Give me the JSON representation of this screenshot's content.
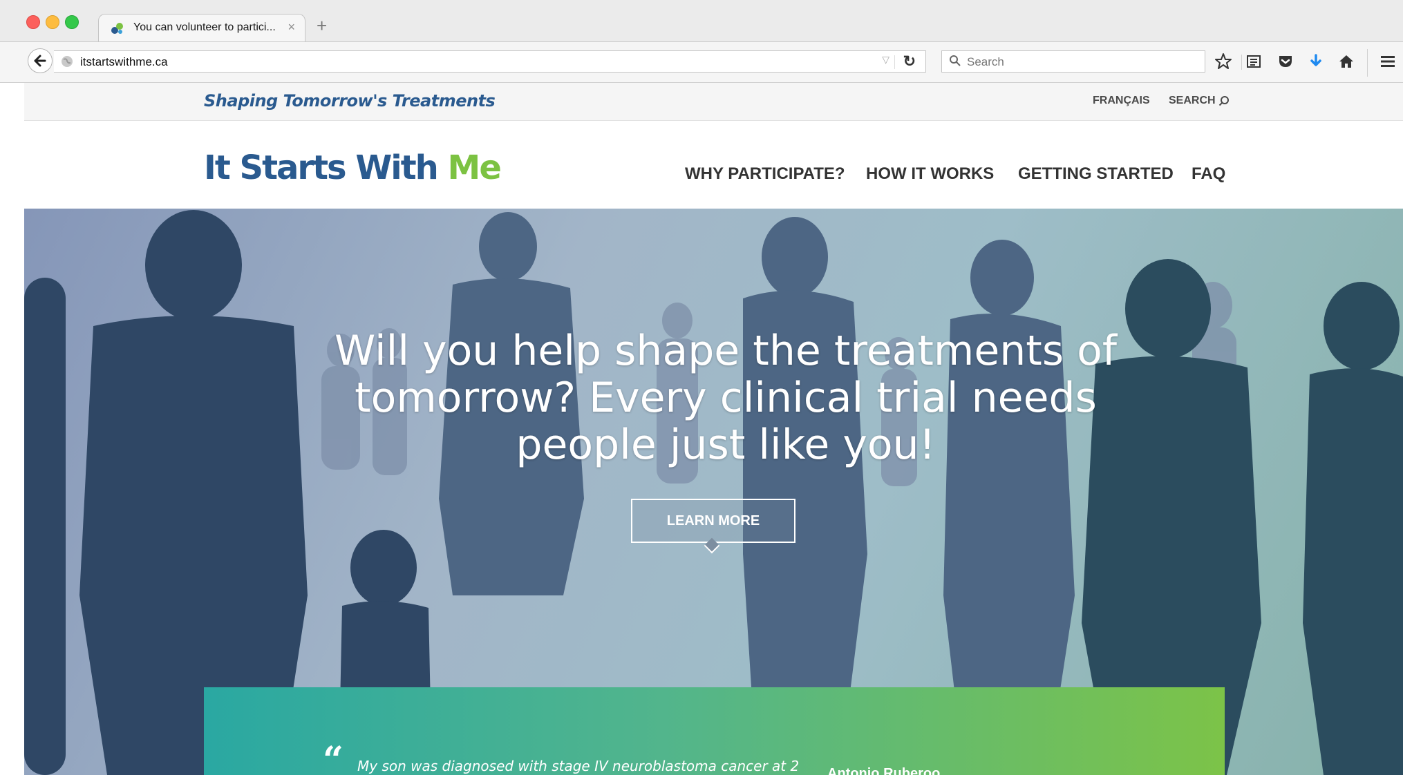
{
  "browser": {
    "tab": {
      "title": "You can volunteer to partici...",
      "close_glyph": "×"
    },
    "new_tab_glyph": "+",
    "url": "itstartswithme.ca",
    "search_placeholder": "Search",
    "icons": [
      "back-arrow-icon",
      "globe-icon",
      "dropmarker-icon",
      "reload-icon",
      "search-icon",
      "bookmark-star-icon",
      "reading-list-icon",
      "pocket-icon",
      "download-icon",
      "home-icon",
      "hamburger-menu-icon"
    ]
  },
  "site": {
    "utility": {
      "tagline": "Shaping Tomorrow's Treatments",
      "francais": "FRANÇAIS",
      "search": "SEARCH"
    },
    "logo": {
      "main": "It Starts With ",
      "accent": "Me"
    },
    "nav": {
      "why": "WHY PARTICIPATE?",
      "how": "HOW IT WORKS",
      "getting": "GETTING STARTED",
      "faq": "FAQ"
    },
    "hero": {
      "headline": "Will you help shape the treatments of tomorrow? Every clinical trial needs people just like you!",
      "button": "LEARN MORE"
    },
    "quote": {
      "mark": "“",
      "text": "My son was diagnosed with stage IV neuroblastoma cancer at 2",
      "author": "Antonio Ruberoo"
    },
    "colors": {
      "brand_blue": "#2a5a8f",
      "brand_green": "#7cc242",
      "quote_gradient_start": "#2aa8a2",
      "quote_gradient_end": "#7cc348"
    }
  }
}
